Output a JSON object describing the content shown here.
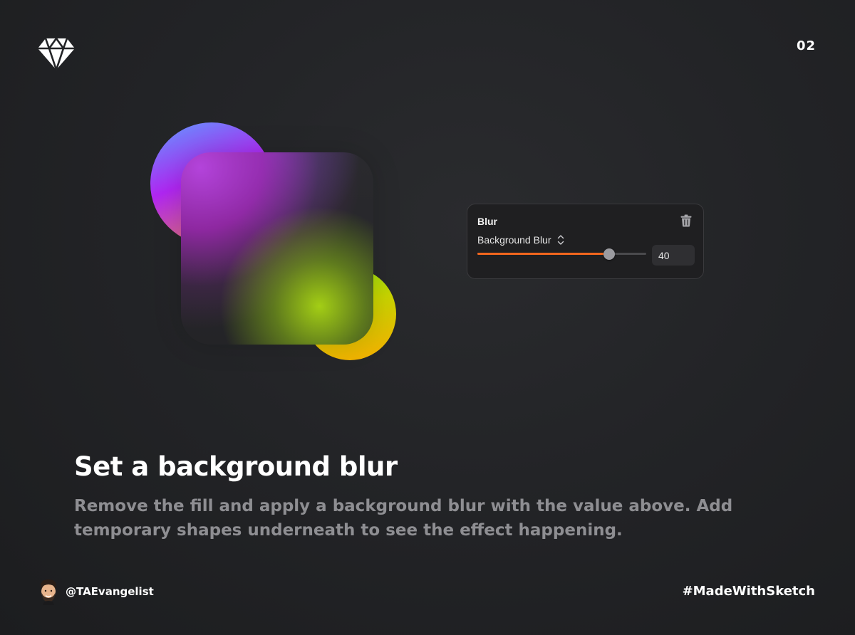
{
  "header": {
    "logo_icon": "sketch-diamond-icon",
    "page_number": "02"
  },
  "blur_panel": {
    "title": "Blur",
    "delete_icon": "trash-icon",
    "blur_type": "Background Blur",
    "blur_type_icon": "up-down-chevron-icon",
    "slider_value_percent": 78,
    "value": "40",
    "accent_color": "#f2661d"
  },
  "content": {
    "heading": "Set a background blur",
    "description": "Remove the fill and apply a background blur with the value above. Add temporary shapes underneath to see the effect happening."
  },
  "footer": {
    "author_handle": "@TAEvangelist",
    "hashtag": "#MadeWithSketch"
  }
}
